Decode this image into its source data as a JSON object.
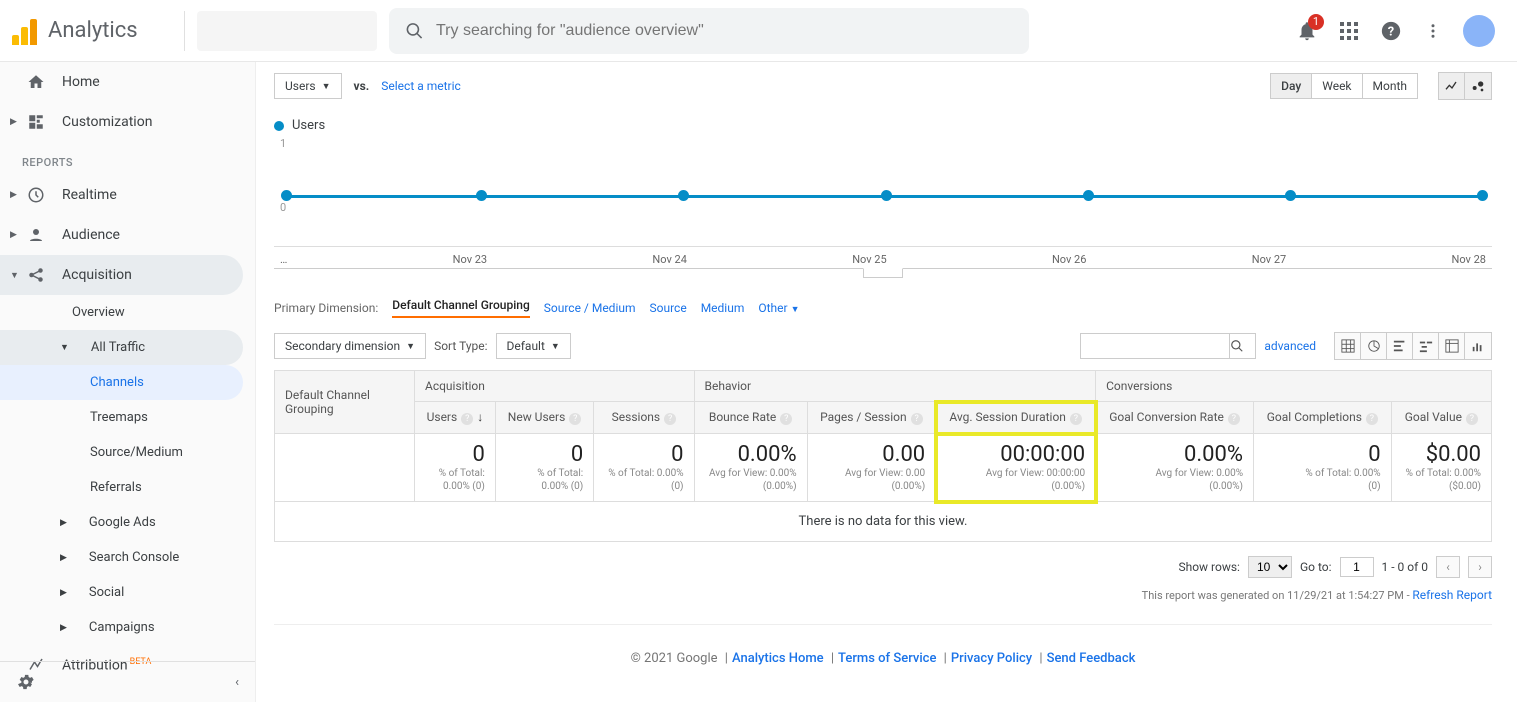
{
  "header": {
    "product": "Analytics",
    "search_placeholder": "Try searching for \"audience overview\"",
    "notification_count": "1"
  },
  "sidebar": {
    "home": "Home",
    "customization": "Customization",
    "reports_label": "REPORTS",
    "items": [
      "Realtime",
      "Audience",
      "Acquisition"
    ],
    "acq_children": {
      "overview": "Overview",
      "all_traffic": "All Traffic",
      "channels": "Channels",
      "treemaps": "Treemaps",
      "source_medium": "Source/Medium",
      "referrals": "Referrals",
      "google_ads": "Google Ads",
      "search_console": "Search Console",
      "social": "Social",
      "campaigns": "Campaigns"
    },
    "attribution": "Attribution",
    "beta": "BETA"
  },
  "controls": {
    "metric_dropdown": "Users",
    "vs": "vs.",
    "select_metric": "Select a metric",
    "ranges": [
      "Day",
      "Week",
      "Month"
    ]
  },
  "chart_data": {
    "type": "line",
    "series_name": "Users",
    "y_ticks": [
      "1",
      "0"
    ],
    "x_ticks": [
      "…",
      "Nov 23",
      "Nov 24",
      "Nov 25",
      "Nov 26",
      "Nov 27",
      "Nov 28"
    ],
    "values": [
      0,
      0,
      0,
      0,
      0,
      0,
      0
    ]
  },
  "dimensions": {
    "label": "Primary Dimension:",
    "active": "Default Channel Grouping",
    "others": [
      "Source / Medium",
      "Source",
      "Medium",
      "Other"
    ]
  },
  "toolbar": {
    "secondary_dimension": "Secondary dimension",
    "sort_label": "Sort Type:",
    "sort_value": "Default",
    "advanced": "advanced"
  },
  "table": {
    "row_header": "Default Channel Grouping",
    "groups": [
      "Acquisition",
      "Behavior",
      "Conversions"
    ],
    "cols": [
      {
        "name": "Users",
        "val": "0",
        "sub1": "% of Total:",
        "sub2": "0.00% (0)",
        "sorted": true
      },
      {
        "name": "New Users",
        "val": "0",
        "sub1": "% of Total:",
        "sub2": "0.00% (0)"
      },
      {
        "name": "Sessions",
        "val": "0",
        "sub1": "% of Total: 0.00%",
        "sub2": "(0)"
      },
      {
        "name": "Bounce Rate",
        "val": "0.00%",
        "sub1": "Avg for View: 0.00%",
        "sub2": "(0.00%)"
      },
      {
        "name": "Pages / Session",
        "val": "0.00",
        "sub1": "Avg for View: 0.00",
        "sub2": "(0.00%)"
      },
      {
        "name": "Avg. Session Duration",
        "val": "00:00:00",
        "sub1": "Avg for View: 00:00:00",
        "sub2": "(0.00%)",
        "highlight": true
      },
      {
        "name": "Goal Conversion Rate",
        "val": "0.00%",
        "sub1": "Avg for View: 0.00%",
        "sub2": "(0.00%)"
      },
      {
        "name": "Goal Completions",
        "val": "0",
        "sub1": "% of Total: 0.00%",
        "sub2": "(0)"
      },
      {
        "name": "Goal Value",
        "val": "$0.00",
        "sub1": "% of Total: 0.00%",
        "sub2": "($0.00)"
      }
    ],
    "no_data": "There is no data for this view."
  },
  "pager": {
    "show_rows": "Show rows:",
    "rows_value": "10",
    "goto": "Go to:",
    "goto_value": "1",
    "range": "1 - 0 of 0"
  },
  "generated": {
    "text": "This report was generated on 11/29/21 at 1:54:27 PM - ",
    "refresh": "Refresh Report"
  },
  "footer": {
    "copyright": "© 2021 Google",
    "links": [
      "Analytics Home",
      "Terms of Service",
      "Privacy Policy",
      "Send Feedback"
    ]
  }
}
